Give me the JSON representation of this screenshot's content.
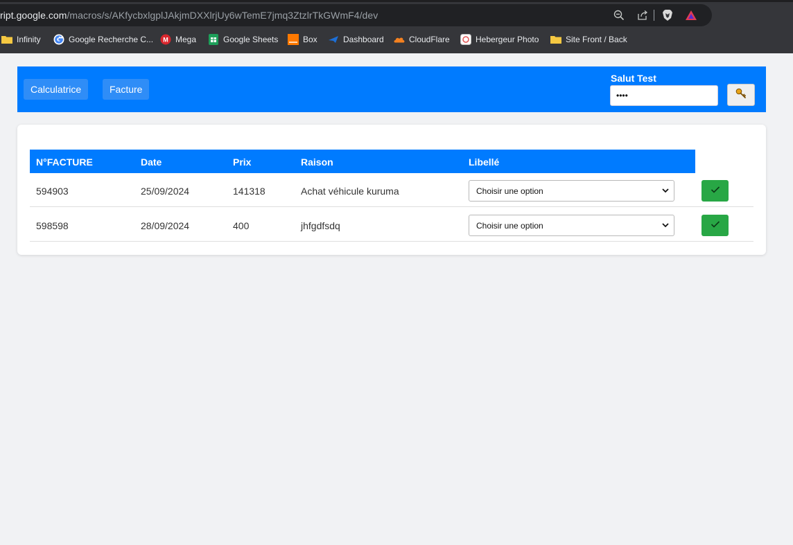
{
  "browser": {
    "url_host": "ript.google.com",
    "url_path": "/macros/s/AKfycbxlgplJAkjmDXXlrjUy6wTemE7jmq3ZtzlrTkGWmF4/dev",
    "omnibox_icons": [
      "zoom-icon",
      "share-icon",
      "brave-shield-icon",
      "brave-rewards-icon"
    ],
    "bookmarks": [
      {
        "label": "Infinity",
        "icon": "folder-icon"
      },
      {
        "label": "Google Recherche C...",
        "icon": "google-icon"
      },
      {
        "label": "Mega",
        "icon": "mega-icon"
      },
      {
        "label": "Google Sheets",
        "icon": "sheets-icon"
      },
      {
        "label": "Box",
        "icon": "box-icon"
      },
      {
        "label": "Dashboard",
        "icon": "dashboard-icon"
      },
      {
        "label": "CloudFlare",
        "icon": "cloudflare-icon"
      },
      {
        "label": "Hebergeur Photo",
        "icon": "photo-icon"
      },
      {
        "label": "Site Front / Back",
        "icon": "folder-icon"
      }
    ]
  },
  "header": {
    "nav": [
      {
        "label": "Calculatrice"
      },
      {
        "label": "Facture"
      }
    ],
    "greeting": "Salut Test",
    "password_value": "••••",
    "key_icon": "key-icon"
  },
  "table": {
    "columns": [
      "N°FACTURE",
      "Date",
      "Prix",
      "Raison",
      "Libellé"
    ],
    "rows": [
      {
        "numero": "594903",
        "date": "25/09/2024",
        "prix": "141318",
        "raison": "Achat véhicule kuruma",
        "libelle": "Choisir une option"
      },
      {
        "numero": "598598",
        "date": "28/09/2024",
        "prix": "400",
        "raison": "jhfgdfsdq",
        "libelle": "Choisir une option"
      }
    ]
  },
  "colors": {
    "primary": "#007bff",
    "success": "#28a745",
    "page_bg": "#f1f2f4",
    "chrome_bg": "#35363a"
  }
}
